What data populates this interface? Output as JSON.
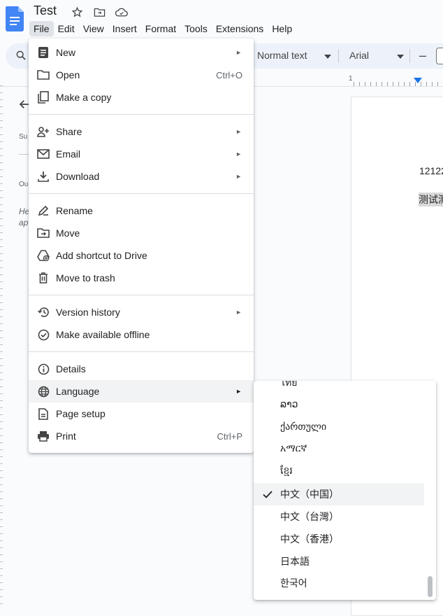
{
  "app": {
    "doc_title": "Test",
    "colors": {
      "doc_blue": "#4285f4",
      "accent": "#1a73e8",
      "highlight": "#f1f3f4"
    }
  },
  "menubar": {
    "items": [
      "File",
      "Edit",
      "View",
      "Insert",
      "Format",
      "Tools",
      "Extensions",
      "Help"
    ],
    "active": "File"
  },
  "toolbar": {
    "paragraph_style": "Normal text",
    "font": "Arial",
    "decrease_size": "–"
  },
  "outline": {
    "summary_label": "Su",
    "outline_label": "Ou",
    "hint_line1": "He",
    "hint_line2": "ap"
  },
  "ruler": {
    "label": "1"
  },
  "document": {
    "line1": "12122",
    "line2": "测试测"
  },
  "file_menu": {
    "items": [
      {
        "label": "New",
        "icon": "doc-icon",
        "shortcut": "",
        "submenu": true
      },
      {
        "label": "Open",
        "icon": "folder-icon",
        "shortcut": "Ctrl+O",
        "submenu": false
      },
      {
        "label": "Make a copy",
        "icon": "copy-icon",
        "shortcut": "",
        "submenu": false
      },
      {
        "label": "Share",
        "icon": "person-add-icon",
        "shortcut": "",
        "submenu": true
      },
      {
        "label": "Email",
        "icon": "mail-icon",
        "shortcut": "",
        "submenu": true
      },
      {
        "label": "Download",
        "icon": "download-icon",
        "shortcut": "",
        "submenu": true
      },
      {
        "label": "Rename",
        "icon": "rename-icon",
        "shortcut": "",
        "submenu": false
      },
      {
        "label": "Move",
        "icon": "move-folder-icon",
        "shortcut": "",
        "submenu": false
      },
      {
        "label": "Add shortcut to Drive",
        "icon": "drive-shortcut-icon",
        "shortcut": "",
        "submenu": false
      },
      {
        "label": "Move to trash",
        "icon": "trash-icon",
        "shortcut": "",
        "submenu": false
      },
      {
        "label": "Version history",
        "icon": "history-icon",
        "shortcut": "",
        "submenu": true
      },
      {
        "label": "Make available offline",
        "icon": "offline-icon",
        "shortcut": "",
        "submenu": false
      },
      {
        "label": "Details",
        "icon": "info-icon",
        "shortcut": "",
        "submenu": false
      },
      {
        "label": "Language",
        "icon": "globe-icon",
        "shortcut": "",
        "submenu": true
      },
      {
        "label": "Page setup",
        "icon": "page-setup-icon",
        "shortcut": "",
        "submenu": false
      },
      {
        "label": "Print",
        "icon": "print-icon",
        "shortcut": "Ctrl+P",
        "submenu": false
      }
    ],
    "submenu_arrow": "►",
    "highlighted": "Language"
  },
  "language_menu": {
    "items": [
      "ไทย",
      "ລາວ",
      "ქართული",
      "አማርኛ",
      "ខ្មែរ",
      "中文（中国）",
      "中文（台灣）",
      "中文（香港）",
      "日本語",
      "한국어"
    ],
    "selected": "中文（中国）"
  }
}
